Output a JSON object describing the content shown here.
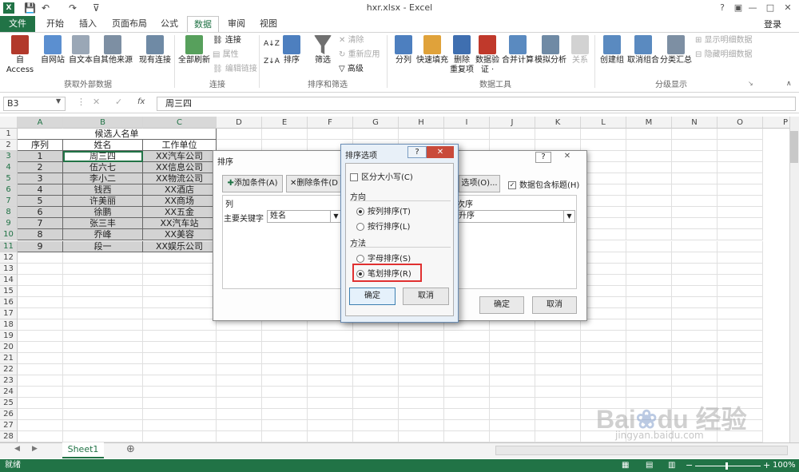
{
  "app": {
    "window_title": "hxr.xlsx - Excel",
    "login": "登录",
    "help": "?"
  },
  "tabs": [
    "文件",
    "开始",
    "插入",
    "页面布局",
    "公式",
    "数据",
    "审阅",
    "视图"
  ],
  "ribbon": {
    "external": {
      "access": "自 Access",
      "web": "自网站",
      "text": "自文本",
      "other": "自其他来源",
      "existing": "现有连接",
      "group": "获取外部数据"
    },
    "connections": {
      "refresh_all": "全部刷新",
      "connections": "连接",
      "properties": "属性",
      "edit_links": "编辑链接",
      "group": "连接"
    },
    "sort": {
      "az": "A↓Z",
      "za": "Z↓A",
      "sort": "排序",
      "filter": "筛选",
      "clear": "清除",
      "reapply": "重新应用",
      "advanced": "高级",
      "group": "排序和筛选"
    },
    "tools": {
      "split": "分列",
      "flash": "快速填充",
      "remove_dup_1": "删除",
      "remove_dup_2": "重复项",
      "validate_1": "数据验",
      "validate_2": "证 ·",
      "consolidate": "合并计算",
      "whatif": "模拟分析",
      "relations": "关系",
      "group": "数据工具"
    },
    "outline": {
      "group_btn": "创建组",
      "ungroup": "取消组合",
      "subtotal": "分类汇总",
      "show_detail": "显示明细数据",
      "hide_detail": "隐藏明细数据",
      "group": "分级显示"
    }
  },
  "formula": {
    "namebox": "B3",
    "fx_label": "fx",
    "value": "周三四"
  },
  "columns": [
    "A",
    "B",
    "C",
    "D",
    "E",
    "F",
    "G",
    "H",
    "I",
    "J",
    "K",
    "L",
    "M",
    "N",
    "O",
    "P"
  ],
  "rows": [
    "1",
    "2",
    "3",
    "4",
    "5",
    "6",
    "7",
    "8",
    "9",
    "10",
    "11",
    "12",
    "13",
    "14",
    "15",
    "16",
    "17",
    "18",
    "19",
    "20",
    "21",
    "22",
    "23",
    "24",
    "25",
    "26",
    "27",
    "28"
  ],
  "table": {
    "title": "候选人名单",
    "headers": [
      "序列",
      "姓名",
      "工作单位"
    ],
    "data": [
      [
        "1",
        "周三四",
        "XX汽车公司"
      ],
      [
        "2",
        "伍六七",
        "XX信息公司"
      ],
      [
        "3",
        "李小二",
        "XX物流公司"
      ],
      [
        "4",
        "钱西",
        "XX酒店"
      ],
      [
        "5",
        "许美丽",
        "XX商场"
      ],
      [
        "6",
        "徐鹏",
        "XX五金"
      ],
      [
        "7",
        "张三丰",
        "XX汽车站"
      ],
      [
        "8",
        "乔峰",
        "XX美容"
      ],
      [
        "9",
        "段一",
        "XX娱乐公司"
      ]
    ]
  },
  "sort_dialog": {
    "title": "排序",
    "help": "?",
    "close": "✕",
    "add": "添加条件(A)",
    "delete": "删除条件(D",
    "options": "选项(O)...",
    "has_header": "数据包含标题(H)",
    "col_header": "列",
    "order_header": "次序",
    "primary_key": "主要关键字",
    "primary_value": "姓名",
    "order_value": "升序",
    "ok": "确定",
    "cancel": "取消"
  },
  "options_dialog": {
    "title": "排序选项",
    "help": "?",
    "close": "✕",
    "case_sensitive": "区分大小写(C)",
    "direction_label": "方向",
    "by_column": "按列排序(T)",
    "by_row": "按行排序(L)",
    "method_label": "方法",
    "alphabetic": "字母排序(S)",
    "stroke": "笔划排序(R)",
    "ok": "确定",
    "cancel": "取消"
  },
  "sheet": {
    "tab": "Sheet1",
    "add": "⊕"
  },
  "status": {
    "ready": "就绪",
    "zoom": "100%",
    "minus": "−",
    "plus": "+"
  },
  "colors": {
    "accent": "#217346",
    "highlight": "#e03030"
  }
}
